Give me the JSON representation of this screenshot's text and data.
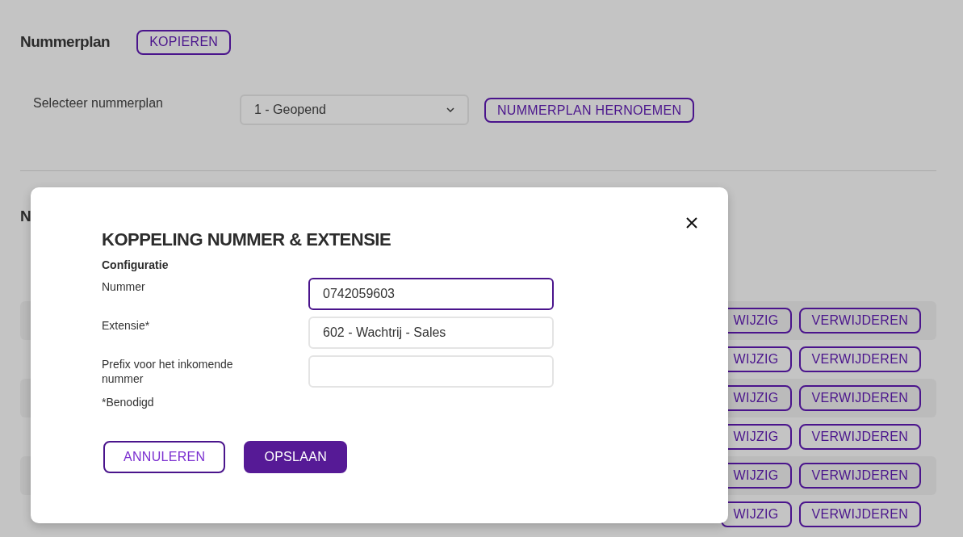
{
  "page": {
    "title": "Nummerplan",
    "copy_button": "KOPIEREN",
    "select_label": "Selecteer nummerplan",
    "select_value": "1 - Geopend",
    "rename_button": "NUMMERPLAN HERNOEMEN",
    "section_title": "N",
    "rows": [
      {
        "edit": "WIJZIG",
        "delete": "VERWIJDEREN"
      },
      {
        "edit": "WIJZIG",
        "delete": "VERWIJDEREN"
      },
      {
        "edit": "WIJZIG",
        "delete": "VERWIJDEREN"
      },
      {
        "edit": "WIJZIG",
        "delete": "VERWIJDEREN"
      },
      {
        "edit": "WIJZIG",
        "delete": "VERWIJDEREN"
      },
      {
        "edit": "WIJZIG",
        "delete": "VERWIJDEREN"
      }
    ]
  },
  "dialog": {
    "title": "KOPPELING NUMMER & EXTENSIE",
    "subtitle": "Configuratie",
    "fields": [
      {
        "label": "Nummer",
        "value": "0742059603",
        "focused": true
      },
      {
        "label": "Extensie*",
        "value": "602 - Wachtrij - Sales",
        "focused": false
      },
      {
        "label": "Prefix voor het inkomende nummer",
        "focused": false
      }
    ],
    "note": "*Benodigd",
    "buttons": [
      {
        "label": "ANNULEREN",
        "kind": "secondary"
      },
      {
        "label": "OPSLAAN",
        "kind": "primary"
      }
    ]
  }
}
